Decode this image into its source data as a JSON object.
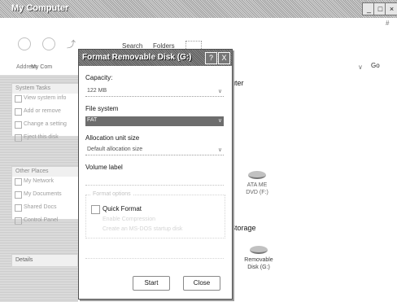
{
  "window": {
    "title": "My Computer",
    "corner_mark": "#"
  },
  "toolbar": {
    "search_label": "Search",
    "folders_label": "Folders"
  },
  "address": {
    "label": "Address",
    "value": "My Com",
    "go_label": "Go"
  },
  "taskpane": {
    "system_tasks_title": "System Tasks",
    "system_items": [
      "View system info",
      "Add or remove",
      "Change a setting",
      "Eject this disk"
    ],
    "other_places_title": "Other Places",
    "other_items": [
      "My Network",
      "My Documents",
      "Shared Docs",
      "Control Panel"
    ],
    "details_title": "Details"
  },
  "main": {
    "section_computer": "uter",
    "section_storage": "Storage",
    "drive_dvd": "ATA ME DVD (F:)",
    "drive_removable": "Removable Disk (G:)"
  },
  "dialog": {
    "title": "Format Removable Disk (G:)",
    "help_label": "?",
    "close_label": "X",
    "capacity_label": "Capacity:",
    "capacity_value": "122 MB",
    "filesystem_label": "File system",
    "filesystem_value": "FAT",
    "allocation_label": "Allocation unit size",
    "allocation_value": "Default allocation size",
    "volume_label": "Volume label",
    "volume_value": "",
    "options_title": "Format options",
    "quick_format_label": "Quick Format",
    "compression_label": "Enable Compression",
    "msdos_label": "Create an MS-DOS startup disk",
    "start_label": "Start",
    "close_btn_label": "Close"
  },
  "colors": {
    "background": "#ffffff",
    "titlebar": "#9a9a9a",
    "selection": "#6f6f6f"
  }
}
